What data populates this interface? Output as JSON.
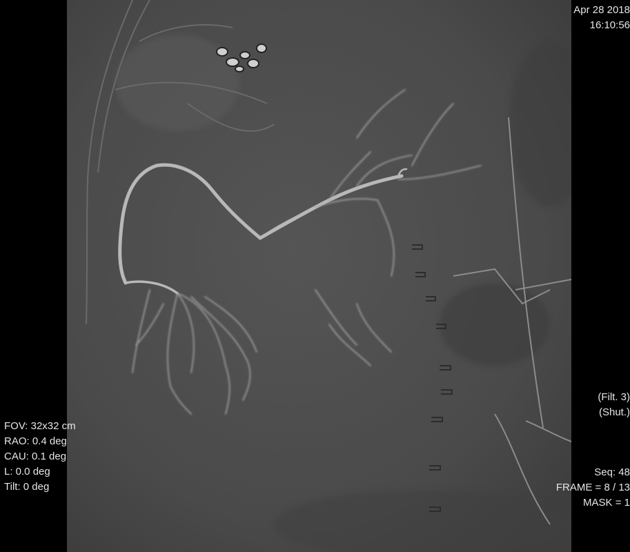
{
  "acquisition": {
    "date": "Apr 28 2018",
    "time": "16:10:56"
  },
  "processing": {
    "filter": "(Filt. 3)",
    "shutter": "(Shut.)"
  },
  "sequence": {
    "seq": "Seq: 48",
    "frame": "FRAME =  8 / 13",
    "mask": "MASK =  1"
  },
  "geometry": {
    "fov": "FOV: 32x32 cm",
    "rao": "RAO: 0.4 deg",
    "cau": "CAU: 0.1 deg",
    "l": "L: 0.0 deg",
    "tilt": "Tilt: 0 deg"
  },
  "colors": {
    "background": "#000000",
    "image_base": "#4a4a4a",
    "overlay_text": "#e6e6e6",
    "vessel": "#b8b8b8"
  }
}
